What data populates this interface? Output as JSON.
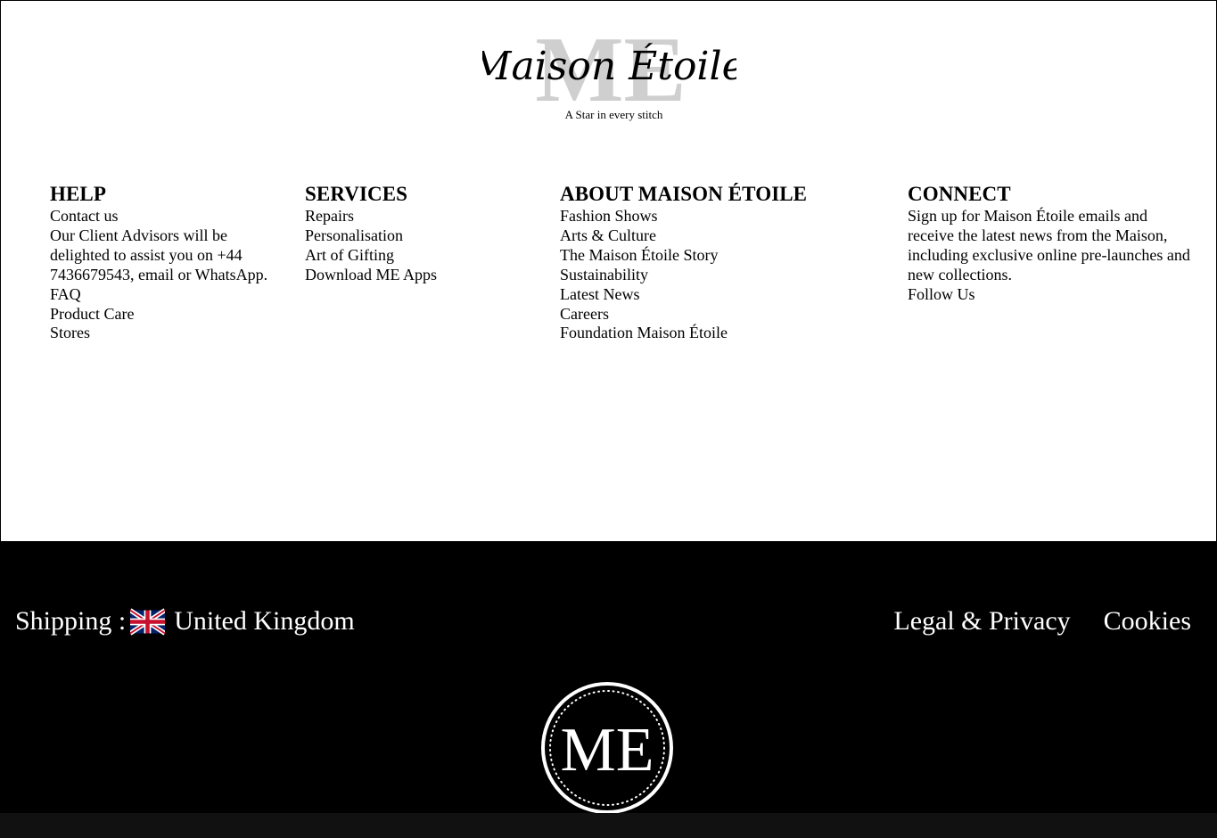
{
  "brand": {
    "name": "Maison Étoile",
    "monogram": "ME",
    "tagline": "A Star in every stitch"
  },
  "columns": {
    "help": {
      "title": "HELP",
      "items": [
        "Contact us",
        "Our Client Advisors will be delighted to assist you on +44 7436679543, email or WhatsApp.",
        "FAQ",
        "Product Care",
        "Stores"
      ]
    },
    "services": {
      "title": "SERVICES",
      "items": [
        "Repairs",
        "Personalisation",
        "Art of Gifting",
        "Download ME Apps"
      ]
    },
    "about": {
      "title": "ABOUT MAISON ÉTOILE",
      "items": [
        "Fashion Shows",
        "Arts & Culture",
        "The Maison Étoile Story",
        "Sustainability",
        "Latest News",
        "Careers",
        "Foundation Maison Étoile"
      ]
    },
    "connect": {
      "title": "CONNECT",
      "items": [
        "Sign up for Maison Étoile emails and receive the latest news from the Maison, including exclusive online pre-launches and new collections.",
        "Follow Us"
      ]
    }
  },
  "footer": {
    "shipping_label": "Shipping :",
    "shipping_country": "United Kingdom",
    "flag_icon": "uk-flag-icon",
    "legal_label": "Legal & Privacy",
    "cookies_label": "Cookies"
  },
  "colors": {
    "background": "#ffffff",
    "footer_bg": "#000000",
    "monogram_gray": "#cfcfcf"
  }
}
